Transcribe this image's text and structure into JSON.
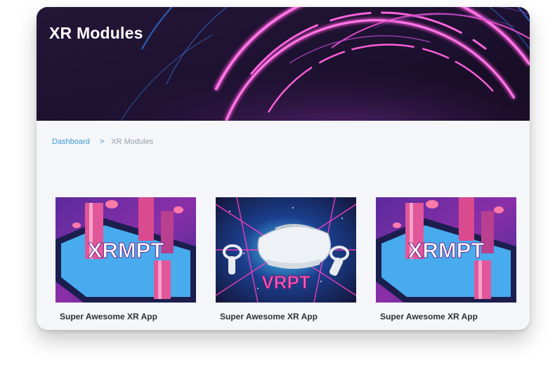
{
  "header": {
    "title": "XR Modules"
  },
  "breadcrumb": {
    "home": "Dashboard",
    "separator": ">",
    "current": "XR Modules"
  },
  "modules": [
    {
      "image_text": "XRMPT",
      "title": "Super Awesome XR App"
    },
    {
      "image_text": "VRPT",
      "title": "Super Awesome XR App"
    },
    {
      "image_text": "XRMPT",
      "title": "Super Awesome XR App"
    }
  ],
  "colors": {
    "hero_bg": "#1a0f28",
    "neon_pink": "#ff4fd8",
    "neon_blue": "#3a7fd6",
    "link": "#3a9bd8",
    "page_bg": "#f4f6f9"
  }
}
